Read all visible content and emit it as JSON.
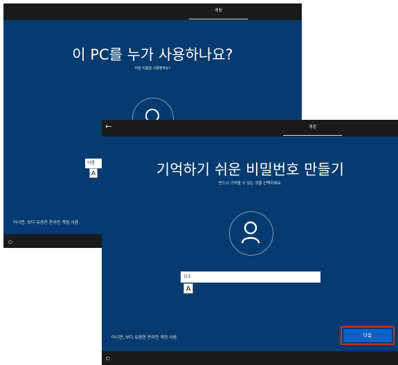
{
  "back_window": {
    "tab_label": "계정",
    "title": "이 PC를 누가 사용하나요?",
    "subtitle": "어떤 이름을 사용할까요?",
    "input_placeholder": "이름",
    "ime_indicator": "A",
    "footer_link": "아니면, 보다 유용한 온라인 계정 사용",
    "power_icon": "⏻"
  },
  "front_window": {
    "back_arrow": "←",
    "tab_label": "계정",
    "title": "기억하기 쉬운 비밀번호 만들기",
    "subtitle": "반드시 기억할 수 있는 것을 선택하세요.",
    "password_placeholder": "암호",
    "ime_indicator": "A",
    "footer_link": "아니면, 보다 유용한 온라인 계정 사용",
    "next_button": "다음",
    "power_icon": "⏻"
  },
  "colors": {
    "oobe_blue": "#063b6f",
    "bar_dark": "#1b1b1b",
    "button_blue": "#0a64c8",
    "highlight_red": "#c0392b"
  }
}
